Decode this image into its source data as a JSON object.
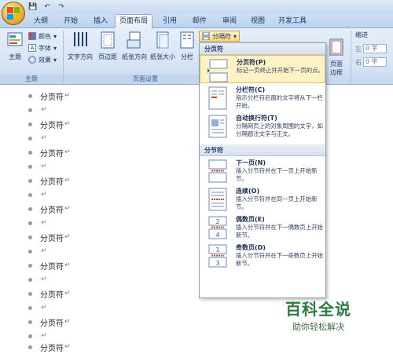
{
  "qat": {
    "save": "💾",
    "undo": "↶",
    "redo": "↷"
  },
  "tabs": [
    "大纲",
    "开始",
    "插入",
    "页面布局",
    "引用",
    "邮件",
    "审阅",
    "视图",
    "开发工具"
  ],
  "ribbon": {
    "theme_label": "主题",
    "colors_label": "颜色",
    "fonts_label": "字体",
    "effects_label": "效果",
    "group_theme": "主题",
    "text_dir": "文字方向",
    "margins": "页边距",
    "orientation": "纸张方向",
    "size": "纸张大小",
    "columns": "分栏",
    "group_page": "页面设置",
    "page_border": "页面\n边框",
    "indent": "缩进",
    "indent_left": "左",
    "indent_right": "右",
    "indent_val": "0 字"
  },
  "split_button": {
    "label": "分隔符"
  },
  "dropdown": {
    "header_page": "分页符",
    "header_section": "分节符",
    "items": [
      {
        "title": "分页符(P)",
        "desc": "标记一页终止并开始下一页的点。"
      },
      {
        "title": "分栏符(C)",
        "desc": "指示分栏符后面的文字将从下一栏开始。"
      },
      {
        "title": "自动换行符(T)",
        "desc": "分隔网页上的对象周围的文字，如分隔题注文字与正文。"
      },
      {
        "title": "下一页(N)",
        "desc": "插入分节符并在下一页上开始新节。"
      },
      {
        "title": "连续(O)",
        "desc": "插入分节符并在同一页上开始新节。"
      },
      {
        "title": "偶数页(E)",
        "desc": "插入分节符并在下一偶数页上开始新节。"
      },
      {
        "title": "奇数页(D)",
        "desc": "插入分节符并在下一奇数页上开始新节。"
      }
    ]
  },
  "doc": {
    "lines": [
      "分页符",
      "",
      "分页符",
      "",
      "分页符",
      "",
      "分页符",
      "",
      "分页符",
      "",
      "分页符",
      "",
      "分页符",
      "",
      "分页符",
      "",
      "分页符",
      "",
      "分页符"
    ],
    "para_mark": "↵"
  },
  "watermark": {
    "title": "百科全说",
    "subtitle": "助你轻松解决"
  }
}
